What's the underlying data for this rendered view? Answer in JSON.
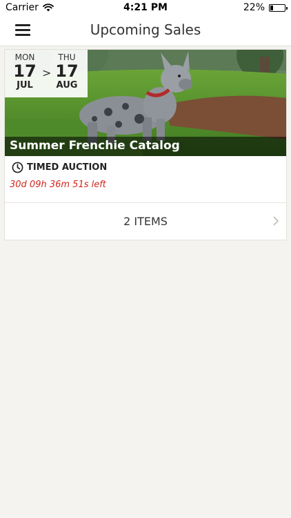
{
  "status_bar": {
    "carrier": "Carrier",
    "time": "4:21 PM",
    "battery": "22%",
    "battery_level": 0.22
  },
  "nav": {
    "title": "Upcoming Sales",
    "menu_icon": "hamburger-menu-icon"
  },
  "sale": {
    "start": {
      "dow": "MON",
      "day": "17",
      "month": "JUL"
    },
    "end": {
      "dow": "THU",
      "day": "17",
      "month": "AUG"
    },
    "arrow": ">",
    "title": "Summer Frenchie Catalog",
    "auction_type": "TIMED AUCTION",
    "time_left": "30d 09h 36m 51s left",
    "items_label": "2 ITEMS",
    "time_left_color": "#d0271d"
  }
}
